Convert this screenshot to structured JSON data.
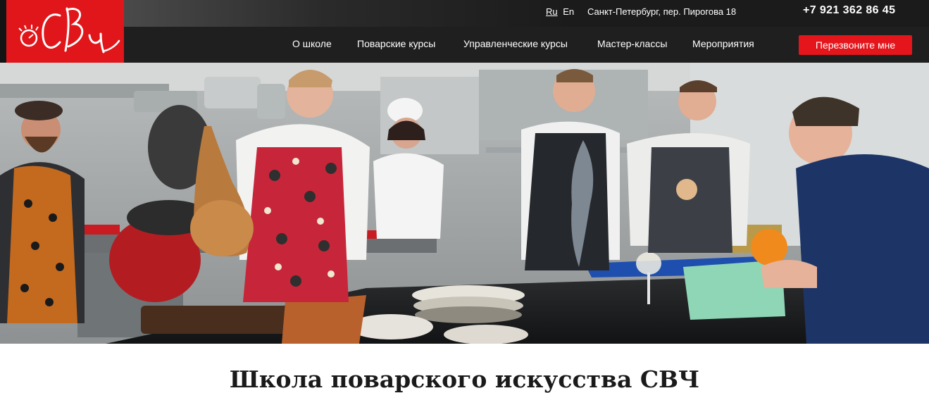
{
  "brand": {
    "logo_text": "СВч"
  },
  "header": {
    "lang_ru": "Ru",
    "lang_en": "En",
    "address": "Санкт-Петербург, пер. Пирогова 18",
    "phone": "+7 921 362 86 45"
  },
  "nav": {
    "items": [
      {
        "label": "О школе"
      },
      {
        "label": "Поварские курсы"
      },
      {
        "label": "Управленческие курсы"
      },
      {
        "label": "Мастер-классы"
      },
      {
        "label": "Мероприятия"
      }
    ],
    "callback_label": "Перезвоните мне"
  },
  "main": {
    "title": "Школа поварского искусства СВЧ"
  },
  "colors": {
    "accent": "#e4161c",
    "header_bg": "#1f1f1f"
  },
  "hero": {
    "icon": "kitchen-team-photo"
  }
}
